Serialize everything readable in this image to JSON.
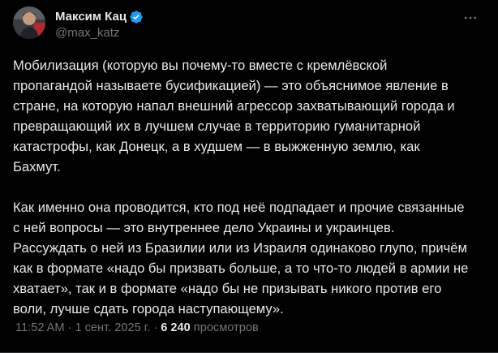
{
  "author": {
    "display_name": "Максим Кац",
    "handle": "@max_katz",
    "verified": true,
    "avatar_icon": "profile-photo"
  },
  "menu": {
    "icon": "more-dots-icon"
  },
  "tweet": {
    "paragraphs": [
      "Мобилизация (которую вы почему-то вместе с кремлёвской\nпропагандой называете бусификацией) — это объяснимое явление в\nстране, на которую напал внешний агрессор захватывающий города и\nпревращающий их в лучшем случае в территорию гуманитарной\nкатастрофы, как Донецк, а в худшем — в выжженную землю, как\nБахмут.",
      "Как именно она проводится, кто под неё подпадает и прочие связанные\nс ней вопросы — это внутреннее дело Украины и украинцев.\nРассуждать о ней из Бразилии или из Израиля одинаково глупо, причём\nкак в формате «надо бы призвать больше, а то что-то людей в армии не\nхватает», так и в формате «надо бы не призывать никого против его\nволи, лучше сдать города наступающему»."
    ]
  },
  "meta": {
    "time": "11:52 AM",
    "separator1": "·",
    "date": "1 сент. 2025 г.",
    "separator2": "·",
    "views_count": "6 240",
    "views_label": "просмотров"
  },
  "colors": {
    "background": "#000000",
    "text": "#e7e9ea",
    "secondary": "#71767b",
    "verified_blue": "#1d9bf0",
    "divider": "#2f3336"
  }
}
